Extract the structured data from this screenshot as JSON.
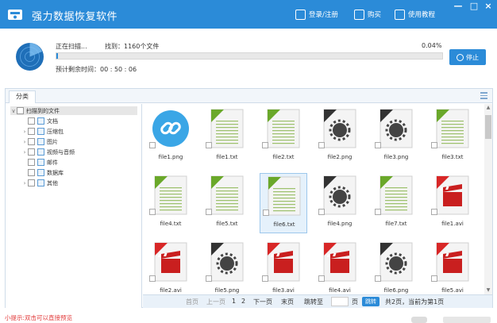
{
  "titlebar": {
    "app_title": "强力数据恢复软件",
    "login_label": "登录/注册",
    "buy_label": "购买",
    "tutorial_label": "使用教程",
    "min_label": "—",
    "max_label": "□",
    "close_label": "×"
  },
  "scan": {
    "status_label": "正在扫描...",
    "found_label": "找到：1160个文件",
    "percent_label": "0.04%",
    "progress_fraction": 0.0004,
    "remaining_label": "预计剩余时间：00 : 50 : 06",
    "stop_label": "停止"
  },
  "tabs": {
    "category_label": "分类"
  },
  "tree": {
    "root_label": "扫描到的文件",
    "items": [
      {
        "label": "文档",
        "icon": "document-icon",
        "has_children": false
      },
      {
        "label": "压缩包",
        "icon": "archive-icon",
        "has_children": true
      },
      {
        "label": "图片",
        "icon": "image-icon",
        "has_children": true
      },
      {
        "label": "视频与音频",
        "icon": "video-icon",
        "has_children": true
      },
      {
        "label": "邮件",
        "icon": "mail-icon",
        "has_children": false
      },
      {
        "label": "数据库",
        "icon": "database-icon",
        "has_children": false
      },
      {
        "label": "其他",
        "icon": "other-icon",
        "has_children": true
      }
    ]
  },
  "files": [
    {
      "name": "file1.png",
      "type": "link"
    },
    {
      "name": "file1.txt",
      "type": "txt"
    },
    {
      "name": "file2.txt",
      "type": "txt"
    },
    {
      "name": "file2.png",
      "type": "png"
    },
    {
      "name": "file3.png",
      "type": "png"
    },
    {
      "name": "file3.txt",
      "type": "txt"
    },
    {
      "name": "file4.txt",
      "type": "txt"
    },
    {
      "name": "file5.txt",
      "type": "txt"
    },
    {
      "name": "file6.txt",
      "type": "txt",
      "selected": true
    },
    {
      "name": "file4.png",
      "type": "png"
    },
    {
      "name": "file7.txt",
      "type": "txt"
    },
    {
      "name": "file1.avi",
      "type": "avi"
    },
    {
      "name": "file2.avi",
      "type": "avi"
    },
    {
      "name": "file5.png",
      "type": "png"
    },
    {
      "name": "file3.avi",
      "type": "avi"
    },
    {
      "name": "file4.avi",
      "type": "avi"
    },
    {
      "name": "file6.png",
      "type": "png"
    },
    {
      "name": "file5.avi",
      "type": "avi"
    }
  ],
  "pager": {
    "first": "首页",
    "prev": "上一页",
    "page1": "1",
    "page2": "2",
    "next": "下一页",
    "last": "末页",
    "jump_to": "跳转至",
    "page_unit": "页",
    "go": "跳转",
    "summary": "共2页，当前为第1页"
  },
  "footer": {
    "tip": "小提示:双击可以直接预览"
  },
  "colors": {
    "accent": "#2b8bd8",
    "txt_badge": "#6aa82a",
    "png_badge": "#333333",
    "avi_badge": "#d82727",
    "tip": "#e23b3b"
  }
}
